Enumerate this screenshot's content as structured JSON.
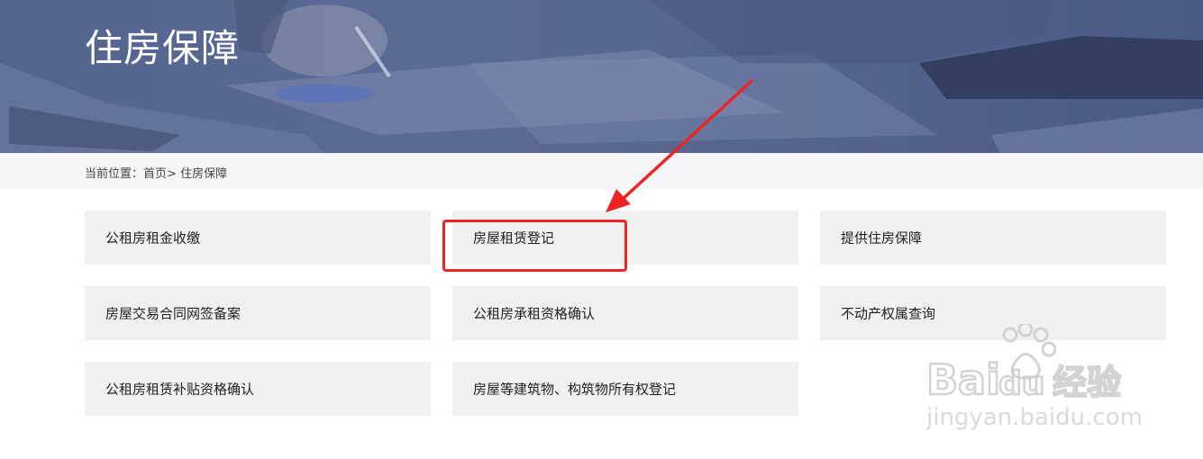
{
  "banner": {
    "title": "住房保障"
  },
  "breadcrumb": {
    "prefix": "当前位置：",
    "home": "首页",
    "separator": ">",
    "current": "住房保障"
  },
  "services": [
    {
      "label": "公租房租金收缴"
    },
    {
      "label": "房屋租赁登记"
    },
    {
      "label": "提供住房保障"
    },
    {
      "label": "房屋交易合同网签备案"
    },
    {
      "label": "公租房承租资格确认"
    },
    {
      "label": "不动产权属查询"
    },
    {
      "label": "公租房租赁补贴资格确认"
    },
    {
      "label": "房屋等建筑物、构筑物所有权登记"
    }
  ],
  "annotation": {
    "color": "#ee2424",
    "target": "房屋租赁登记"
  },
  "watermark": {
    "brand": "Baidu经验",
    "url": "jingyan.baidu.com"
  }
}
